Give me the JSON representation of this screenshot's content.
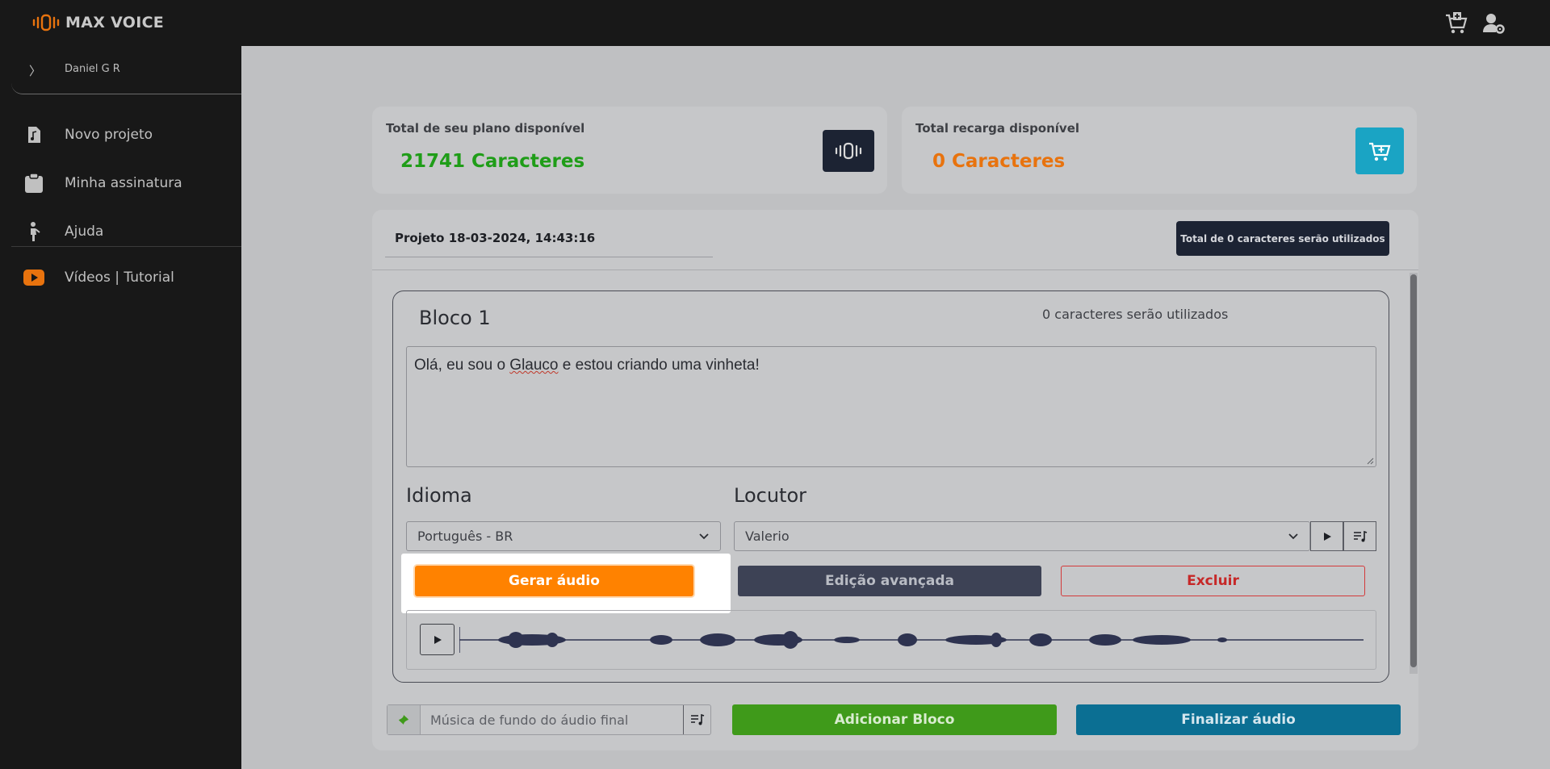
{
  "app": {
    "name": "MAX VOICE"
  },
  "sidebar": {
    "user_name": "Daniel G R",
    "items": [
      {
        "label": "Novo projeto",
        "icon": "music-file-icon"
      },
      {
        "label": "Minha assinatura",
        "icon": "clipboard-icon"
      },
      {
        "label": "Ajuda",
        "icon": "person-help-icon"
      },
      {
        "label": "Vídeos | Tutorial",
        "icon": "youtube-icon"
      }
    ]
  },
  "stats": {
    "plan": {
      "title": "Total de seu plano disponível",
      "value": "21741 Caracteres",
      "color": "#1f9d18"
    },
    "recharge": {
      "title": "Total recarga disponível",
      "value": "0 Caracteres",
      "color": "#e8730e"
    }
  },
  "project": {
    "title": "Projeto 18-03-2024, 14:43:16",
    "total_badge": "Total de 0 caracteres serão utilizados"
  },
  "block": {
    "title": "Bloco 1",
    "chars_used": "0 caracteres serão utilizados",
    "text_before": "Olá, eu sou o ",
    "text_misspelled": "Glauco",
    "text_after": " e estou criando uma vinheta!",
    "language_label": "Idioma",
    "language_value": "Português - BR",
    "speaker_label": "Locutor",
    "speaker_value": "Valerio",
    "generate_label": "Gerar áudio",
    "advanced_label": "Edição avançada",
    "delete_label": "Excluir"
  },
  "footer": {
    "music_placeholder": "Música de fundo do áudio final",
    "add_block_label": "Adicionar Bloco",
    "finish_label": "Finalizar áudio"
  },
  "colors": {
    "accent_orange": "#ff8200",
    "green": "#3f9a1a",
    "blue": "#0b6f93",
    "dark_navy": "#1c2333",
    "cyan": "#1aa4c4"
  }
}
